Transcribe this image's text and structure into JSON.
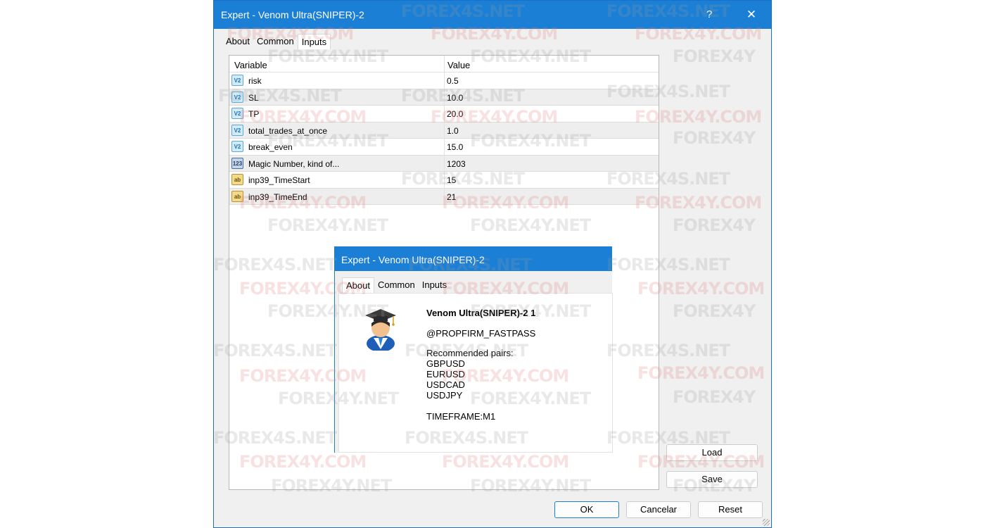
{
  "window": {
    "title": "Expert - Venom Ultra(SNIPER)-2",
    "help": "?",
    "close": "✕"
  },
  "tabs": [
    "About",
    "Common",
    "Inputs"
  ],
  "grid": {
    "headers": {
      "variable": "Variable",
      "value": "Value"
    },
    "rows": [
      {
        "icon": "v2",
        "icon_text": "V2",
        "variable": "risk",
        "value": "0.5"
      },
      {
        "icon": "v2",
        "icon_text": "V2",
        "variable": "SL",
        "value": "10.0"
      },
      {
        "icon": "v2",
        "icon_text": "V2",
        "variable": "TP",
        "value": "20.0"
      },
      {
        "icon": "v2",
        "icon_text": "V2",
        "variable": "total_trades_at_once",
        "value": "1.0"
      },
      {
        "icon": "v2",
        "icon_text": "V2",
        "variable": "break_even",
        "value": "15.0"
      },
      {
        "icon": "n123",
        "icon_text": "123",
        "variable": "Magic Number, kind of...",
        "value": "1203"
      },
      {
        "icon": "ab",
        "icon_text": "ab",
        "variable": "inp39_TimeStart",
        "value": "15"
      },
      {
        "icon": "ab",
        "icon_text": "ab",
        "variable": "inp39_TimeEnd",
        "value": "21"
      }
    ]
  },
  "side_buttons": {
    "load": "Load",
    "save": "Save"
  },
  "footer_buttons": {
    "ok": "OK",
    "cancel": "Cancelar",
    "reset": "Reset"
  },
  "about_dialog": {
    "title": "Expert - Venom Ultra(SNIPER)-2",
    "tabs": [
      "About",
      "Common",
      "Inputs"
    ],
    "name": "Venom Ultra(SNIPER)-2 1",
    "author": "@PROPFIRM_FASTPASS",
    "description": "Recommended pairs:\nGBPUSD\nEURUSD\nUSDCAD\nUSDJPY\n\nTIMEFRAME:M1"
  },
  "watermarks": {
    "a": "FOREX4S.NET",
    "b": "FOREX4Y.COM",
    "c": "FOREX4Y.NET",
    "d": "FOREX4Y"
  },
  "colors": {
    "titlebar": "#1b7fd6",
    "window_bg": "#f0f0f0"
  }
}
